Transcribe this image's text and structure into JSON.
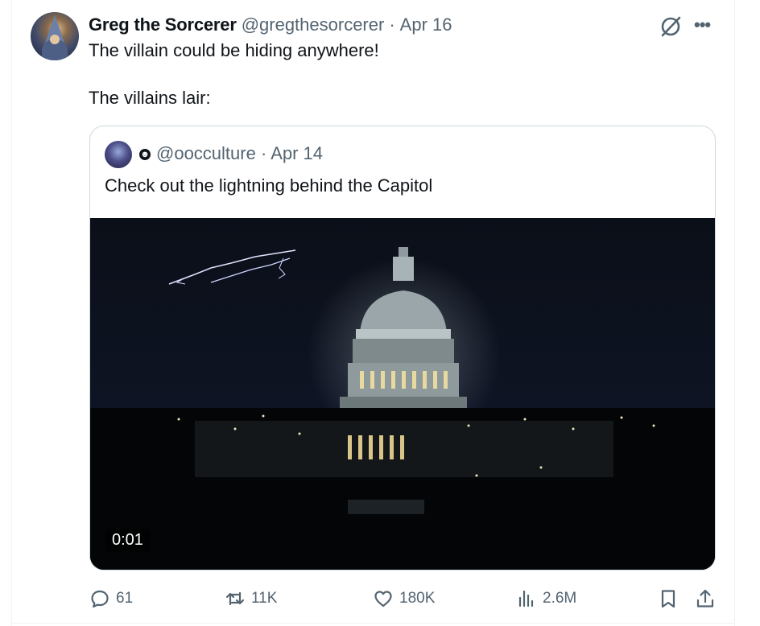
{
  "tweet": {
    "author_name": "Greg the Sorcerer",
    "handle": "@gregthesorcerer",
    "separator": "·",
    "date": "Apr 16",
    "text_line1": "The villain could be hiding anywhere!",
    "text_line2": "The villains lair:"
  },
  "quote": {
    "handle": "@oocculture",
    "separator": "·",
    "date": "Apr 14",
    "text": "Check out the lightning behind the Capitol",
    "video_time": "0:01"
  },
  "actions": {
    "replies": "61",
    "reposts": "11K",
    "likes": "180K",
    "views": "2.6M"
  },
  "icons": {
    "reply": "speech-bubble-icon",
    "repost": "repost-arrows-icon",
    "like": "heart-icon",
    "views": "bar-chart-icon",
    "bookmark": "bookmark-icon",
    "share": "share-icon",
    "grok": "grok-icon",
    "more": "more-dots-icon",
    "badge": "smiley-badge-icon"
  },
  "colors": {
    "text_primary": "#0f1419",
    "text_secondary": "#536471",
    "border": "#cfd9de"
  }
}
